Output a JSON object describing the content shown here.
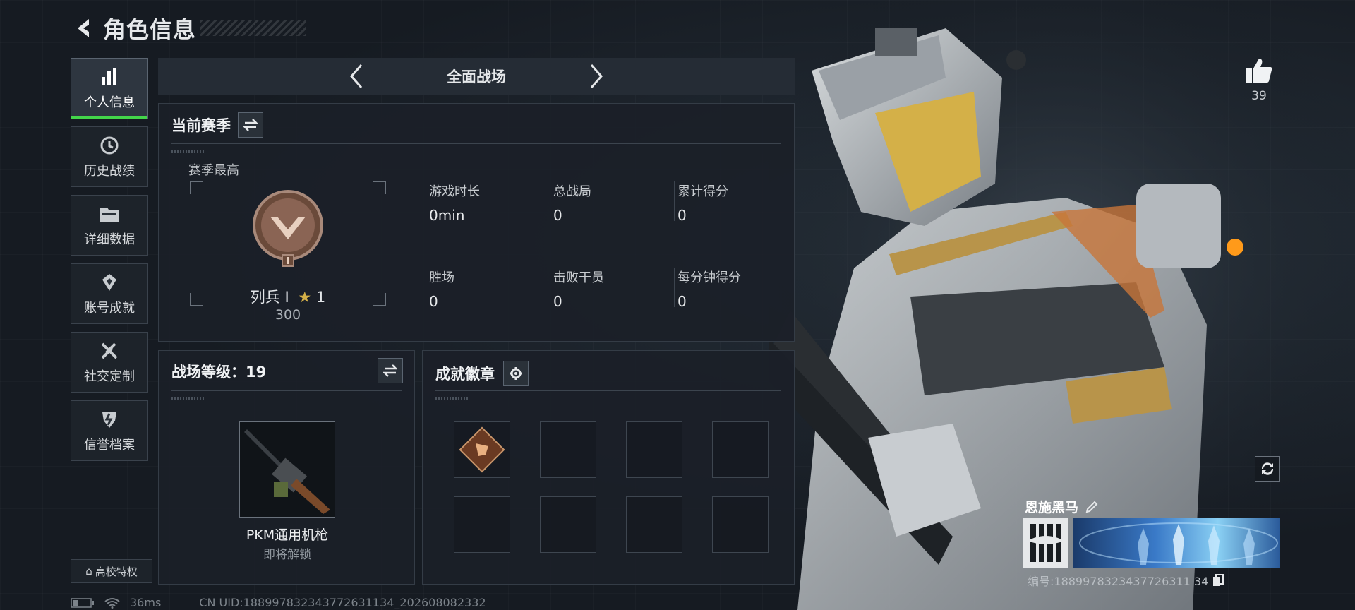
{
  "header": {
    "title": "角色信息"
  },
  "sidebar": {
    "items": [
      {
        "label": "个人信息",
        "icon": "bar-chart-icon",
        "active": true
      },
      {
        "label": "历史战绩",
        "icon": "history-clock-icon",
        "active": false
      },
      {
        "label": "详细数据",
        "icon": "folder-icon",
        "active": false
      },
      {
        "label": "账号成就",
        "icon": "achievement-icon",
        "active": false
      },
      {
        "label": "社交定制",
        "icon": "tools-icon",
        "active": false
      },
      {
        "label": "信誉档案",
        "icon": "shield-emblem-icon",
        "active": false
      }
    ],
    "campus_label": "高校特权"
  },
  "mode": {
    "title": "全面战场"
  },
  "season": {
    "title": "当前赛季",
    "subtitle": "赛季最高",
    "rank_name": "列兵 Ⅰ",
    "rank_stars": "1",
    "rank_score": "300",
    "stats": [
      {
        "label": "游戏时长",
        "value": "0min"
      },
      {
        "label": "总战局",
        "value": "0"
      },
      {
        "label": "累计得分",
        "value": "0"
      },
      {
        "label": "胜场",
        "value": "0"
      },
      {
        "label": "击败干员",
        "value": "0"
      },
      {
        "label": "每分钟得分",
        "value": "0"
      }
    ]
  },
  "level": {
    "title": "战场等级：19",
    "weapon_name": "PKM通用机枪",
    "weapon_status": "即将解锁"
  },
  "badges": {
    "title": "成就徽章"
  },
  "profile": {
    "likes": "39",
    "player_name": "恩施黑马",
    "player_id": "编号:1889978323437726311 34"
  },
  "status": {
    "ping": "36ms",
    "uid": "CN UID:188997832343772631134_202608082332"
  },
  "colors": {
    "accent": "#43d64a",
    "background": "#161b22",
    "panel": "#1b2028"
  }
}
